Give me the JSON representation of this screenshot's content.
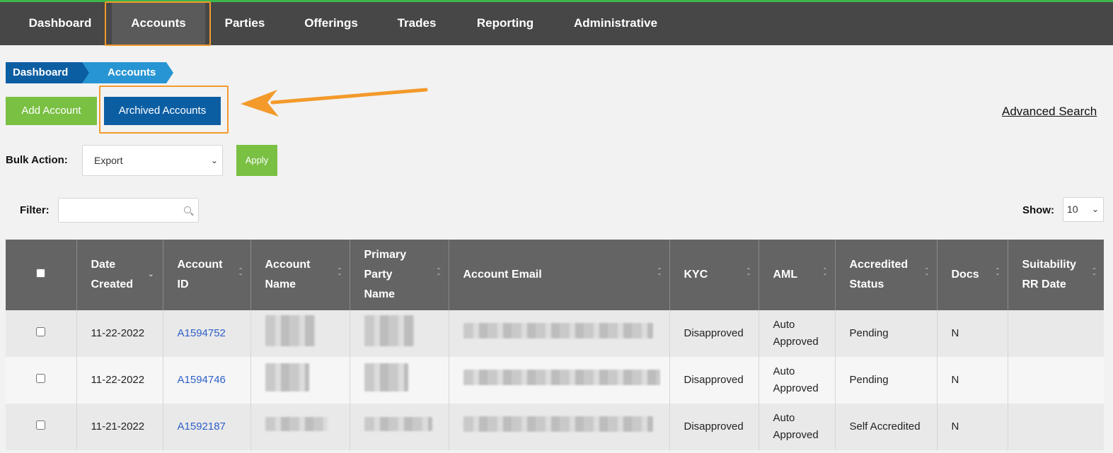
{
  "nav": {
    "items": [
      "Dashboard",
      "Accounts",
      "Parties",
      "Offerings",
      "Trades",
      "Reporting",
      "Administrative"
    ],
    "active": "Accounts"
  },
  "breadcrumb": {
    "items": [
      "Dashboard",
      "Accounts"
    ]
  },
  "actions": {
    "add_account": "Add Account",
    "archived_accounts": "Archived Accounts",
    "advanced_search": "Advanced Search"
  },
  "bulk": {
    "label": "Bulk Action:",
    "selected": "Export",
    "apply": "Apply"
  },
  "filter": {
    "label": "Filter:",
    "value": ""
  },
  "show": {
    "label": "Show:",
    "selected": "10"
  },
  "colors": {
    "nav_bg": "#474747",
    "highlight": "#f39a2b",
    "primary": "#0c5ea3",
    "success": "#7ac043",
    "header_bg": "#646464",
    "link": "#2e5fc9"
  },
  "table": {
    "columns": [
      "Date Created",
      "Account ID",
      "Account Name",
      "Primary Party Name",
      "Account Email",
      "KYC",
      "AML",
      "Accredited Status",
      "Docs",
      "Suitability RR Date"
    ],
    "rows": [
      {
        "date": "11-22-2022",
        "id": "A1594752",
        "kyc": "Disapproved",
        "aml": "Auto Approved",
        "accredited": "Pending",
        "docs": "N",
        "suitability": ""
      },
      {
        "date": "11-22-2022",
        "id": "A1594746",
        "kyc": "Disapproved",
        "aml": "Auto Approved",
        "accredited": "Pending",
        "docs": "N",
        "suitability": ""
      },
      {
        "date": "11-21-2022",
        "id": "A1592187",
        "kyc": "Disapproved",
        "aml": "Auto Approved",
        "accredited": "Self Accredited",
        "docs": "N",
        "suitability": ""
      }
    ]
  }
}
